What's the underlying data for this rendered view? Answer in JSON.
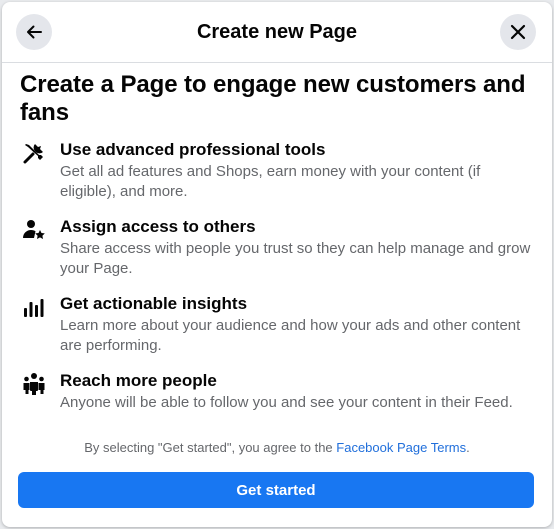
{
  "dialog": {
    "title": "Create new Page",
    "back_icon": "arrow-left-icon",
    "close_icon": "close-icon"
  },
  "headline": "Create a Page to engage new customers and fans",
  "features": [
    {
      "icon": "tools-icon",
      "title": "Use advanced professional tools",
      "description": "Get all ad features and Shops, earn money with your content (if eligible), and more."
    },
    {
      "icon": "person-star-icon",
      "title": "Assign access to others",
      "description": "Share access with people you trust so they can help manage and grow your Page."
    },
    {
      "icon": "bar-chart-icon",
      "title": "Get actionable insights",
      "description": "Learn more about your audience and how your ads and other content are performing."
    },
    {
      "icon": "people-group-icon",
      "title": "Reach more people",
      "description": "Anyone will be able to follow you and see your content in their Feed."
    }
  ],
  "terms": {
    "prefix": "By selecting \"Get started\", you agree to the ",
    "link": "Facebook Page Terms",
    "suffix": "."
  },
  "primary_button": "Get started",
  "colors": {
    "accent": "#1877f2",
    "link": "#216fdb",
    "secondary_text": "#65676b"
  }
}
